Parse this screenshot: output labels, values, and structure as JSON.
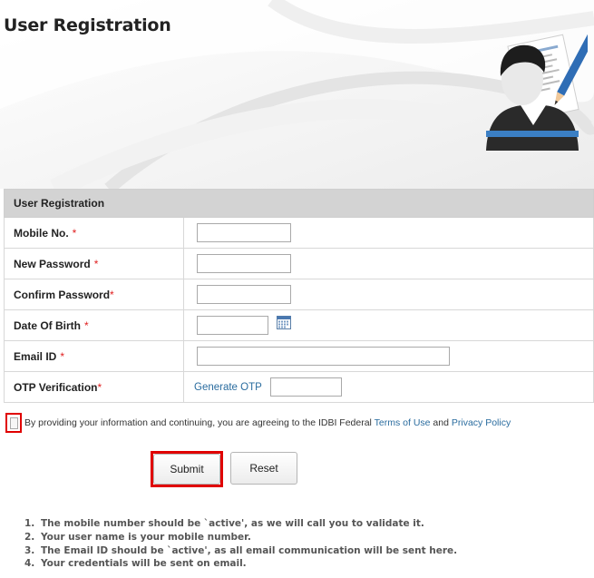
{
  "page": {
    "title": "User Registration",
    "illustration_icon": "user-with-document-and-pencil-icon"
  },
  "form": {
    "section_title": "User Registration",
    "required_marker": "*",
    "fields": {
      "mobile": {
        "label": "Mobile No.",
        "value": ""
      },
      "new_password": {
        "label": "New Password",
        "value": ""
      },
      "confirm_password": {
        "label": "Confirm Password",
        "value": ""
      },
      "dob": {
        "label": "Date Of Birth",
        "value": "",
        "icon": "calendar-icon"
      },
      "email": {
        "label": "Email ID",
        "value": ""
      },
      "otp": {
        "label": "OTP Verification",
        "link_label": "Generate OTP",
        "value": ""
      }
    }
  },
  "consent": {
    "checked": false,
    "text": "By providing your information and continuing, you are agreeing to the IDBI Federal",
    "terms_label": "Terms of Use",
    "and_text": "and",
    "privacy_label": "Privacy Policy"
  },
  "buttons": {
    "submit_label": "Submit",
    "reset_label": "Reset"
  },
  "notes": [
    {
      "num": "1.",
      "text": "The mobile number should be `active', as we will call you to validate it."
    },
    {
      "num": "2.",
      "text": "Your user name is your mobile number."
    },
    {
      "num": "3.",
      "text": "The Email ID should be `active', as all email communication will be sent here."
    },
    {
      "num": "4.",
      "text": "Your credentials will be sent on email."
    }
  ],
  "colors": {
    "header_bg": "#d3d3d3",
    "link": "#2a6c9f",
    "required": "#e02020",
    "highlight": "#e00000"
  }
}
